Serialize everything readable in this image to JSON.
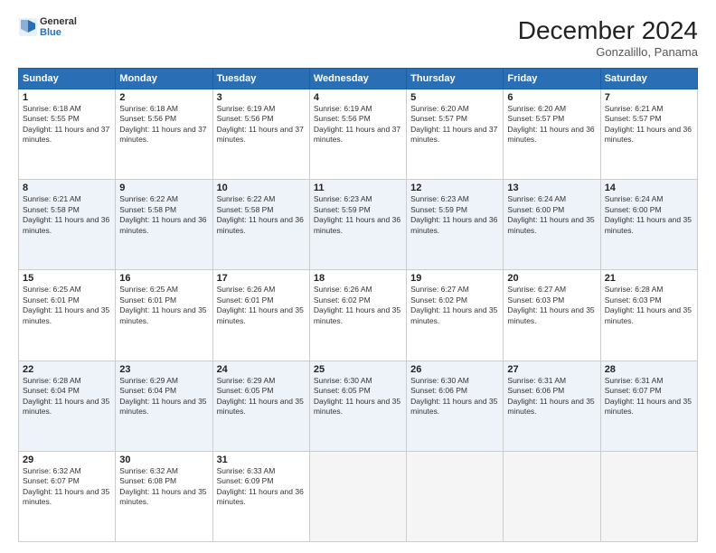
{
  "header": {
    "logo_line1": "General",
    "logo_line2": "Blue",
    "title": "December 2024",
    "subtitle": "Gonzalillo, Panama"
  },
  "columns": [
    "Sunday",
    "Monday",
    "Tuesday",
    "Wednesday",
    "Thursday",
    "Friday",
    "Saturday"
  ],
  "rows": [
    [
      {
        "day": "1",
        "sunrise": "6:18 AM",
        "sunset": "5:55 PM",
        "daylight": "11 hours and 37 minutes."
      },
      {
        "day": "2",
        "sunrise": "6:18 AM",
        "sunset": "5:56 PM",
        "daylight": "11 hours and 37 minutes."
      },
      {
        "day": "3",
        "sunrise": "6:19 AM",
        "sunset": "5:56 PM",
        "daylight": "11 hours and 37 minutes."
      },
      {
        "day": "4",
        "sunrise": "6:19 AM",
        "sunset": "5:56 PM",
        "daylight": "11 hours and 37 minutes."
      },
      {
        "day": "5",
        "sunrise": "6:20 AM",
        "sunset": "5:57 PM",
        "daylight": "11 hours and 37 minutes."
      },
      {
        "day": "6",
        "sunrise": "6:20 AM",
        "sunset": "5:57 PM",
        "daylight": "11 hours and 36 minutes."
      },
      {
        "day": "7",
        "sunrise": "6:21 AM",
        "sunset": "5:57 PM",
        "daylight": "11 hours and 36 minutes."
      }
    ],
    [
      {
        "day": "8",
        "sunrise": "6:21 AM",
        "sunset": "5:58 PM",
        "daylight": "11 hours and 36 minutes."
      },
      {
        "day": "9",
        "sunrise": "6:22 AM",
        "sunset": "5:58 PM",
        "daylight": "11 hours and 36 minutes."
      },
      {
        "day": "10",
        "sunrise": "6:22 AM",
        "sunset": "5:58 PM",
        "daylight": "11 hours and 36 minutes."
      },
      {
        "day": "11",
        "sunrise": "6:23 AM",
        "sunset": "5:59 PM",
        "daylight": "11 hours and 36 minutes."
      },
      {
        "day": "12",
        "sunrise": "6:23 AM",
        "sunset": "5:59 PM",
        "daylight": "11 hours and 36 minutes."
      },
      {
        "day": "13",
        "sunrise": "6:24 AM",
        "sunset": "6:00 PM",
        "daylight": "11 hours and 35 minutes."
      },
      {
        "day": "14",
        "sunrise": "6:24 AM",
        "sunset": "6:00 PM",
        "daylight": "11 hours and 35 minutes."
      }
    ],
    [
      {
        "day": "15",
        "sunrise": "6:25 AM",
        "sunset": "6:01 PM",
        "daylight": "11 hours and 35 minutes."
      },
      {
        "day": "16",
        "sunrise": "6:25 AM",
        "sunset": "6:01 PM",
        "daylight": "11 hours and 35 minutes."
      },
      {
        "day": "17",
        "sunrise": "6:26 AM",
        "sunset": "6:01 PM",
        "daylight": "11 hours and 35 minutes."
      },
      {
        "day": "18",
        "sunrise": "6:26 AM",
        "sunset": "6:02 PM",
        "daylight": "11 hours and 35 minutes."
      },
      {
        "day": "19",
        "sunrise": "6:27 AM",
        "sunset": "6:02 PM",
        "daylight": "11 hours and 35 minutes."
      },
      {
        "day": "20",
        "sunrise": "6:27 AM",
        "sunset": "6:03 PM",
        "daylight": "11 hours and 35 minutes."
      },
      {
        "day": "21",
        "sunrise": "6:28 AM",
        "sunset": "6:03 PM",
        "daylight": "11 hours and 35 minutes."
      }
    ],
    [
      {
        "day": "22",
        "sunrise": "6:28 AM",
        "sunset": "6:04 PM",
        "daylight": "11 hours and 35 minutes."
      },
      {
        "day": "23",
        "sunrise": "6:29 AM",
        "sunset": "6:04 PM",
        "daylight": "11 hours and 35 minutes."
      },
      {
        "day": "24",
        "sunrise": "6:29 AM",
        "sunset": "6:05 PM",
        "daylight": "11 hours and 35 minutes."
      },
      {
        "day": "25",
        "sunrise": "6:30 AM",
        "sunset": "6:05 PM",
        "daylight": "11 hours and 35 minutes."
      },
      {
        "day": "26",
        "sunrise": "6:30 AM",
        "sunset": "6:06 PM",
        "daylight": "11 hours and 35 minutes."
      },
      {
        "day": "27",
        "sunrise": "6:31 AM",
        "sunset": "6:06 PM",
        "daylight": "11 hours and 35 minutes."
      },
      {
        "day": "28",
        "sunrise": "6:31 AM",
        "sunset": "6:07 PM",
        "daylight": "11 hours and 35 minutes."
      }
    ],
    [
      {
        "day": "29",
        "sunrise": "6:32 AM",
        "sunset": "6:07 PM",
        "daylight": "11 hours and 35 minutes."
      },
      {
        "day": "30",
        "sunrise": "6:32 AM",
        "sunset": "6:08 PM",
        "daylight": "11 hours and 35 minutes."
      },
      {
        "day": "31",
        "sunrise": "6:33 AM",
        "sunset": "6:09 PM",
        "daylight": "11 hours and 36 minutes."
      },
      null,
      null,
      null,
      null
    ]
  ],
  "labels": {
    "sunrise": "Sunrise:",
    "sunset": "Sunset:",
    "daylight": "Daylight:"
  }
}
